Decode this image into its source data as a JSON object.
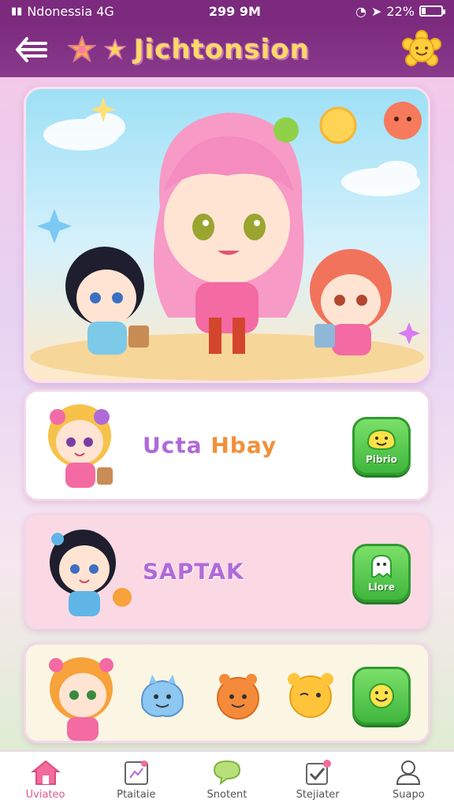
{
  "status": {
    "carrier": "Ndonessia 4G",
    "time": "299 9M",
    "battery": "22%",
    "battery_level": 0.22
  },
  "header": {
    "title": "Jichtonsion"
  },
  "cards": [
    {
      "label_a": "Ucta",
      "label_b": "Hbay",
      "button": "Pibrio"
    },
    {
      "label": "SAPTAK",
      "button": "Llore"
    },
    {
      "label": ""
    }
  ],
  "nav": [
    {
      "label": "Uviateo",
      "icon": "home-icon",
      "active": true
    },
    {
      "label": "Ptaitaie",
      "icon": "card-icon",
      "active": false
    },
    {
      "label": "Snotent",
      "icon": "chat-icon",
      "active": false
    },
    {
      "label": "Stejiater",
      "icon": "check-icon",
      "active": false
    },
    {
      "label": "Suapo",
      "icon": "user-icon",
      "active": false
    }
  ],
  "colors": {
    "header": "#7b2a7e",
    "accent_green": "#3fb63c",
    "title_yellow": "#ffd966",
    "active_nav": "#e05a8a"
  }
}
